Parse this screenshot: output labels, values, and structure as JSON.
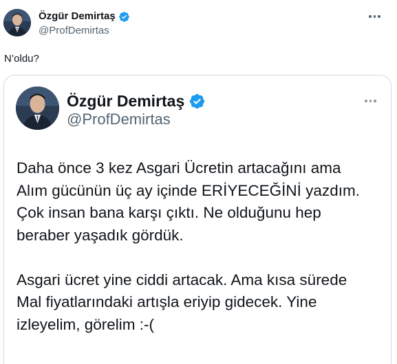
{
  "author": {
    "name": "Özgür Demirtaş",
    "handle": "@ProfDemirtas",
    "verified_icon": "verified-badge-icon",
    "avatar_icon": "profile-photo-avatar"
  },
  "tweet": {
    "text": "N’oldu?",
    "more_icon": "more-options-icon"
  },
  "quoted": {
    "name": "Özgür Demirtaş",
    "handle": "@ProfDemirtas",
    "body_lines": [
      "Daha önce 3 kez Asgari Ücretin artacağını ama",
      "Alım gücünün üç ay içinde ERİYECEĞİNİ yazdım.",
      "Çok insan bana karşı çıktı. Ne olduğunu hep",
      "beraber yaşadık gördük.",
      "",
      "Asgari ücret yine ciddi artacak. Ama kısa sürede",
      "Mal fiyatlarındaki artışla eriyip gidecek. Yine",
      "izleyelim, görelim :-("
    ]
  },
  "colors": {
    "verified_blue": "#1d9bf0",
    "text_primary": "#0f1419",
    "text_secondary": "#536471",
    "border": "#cfd9de"
  }
}
